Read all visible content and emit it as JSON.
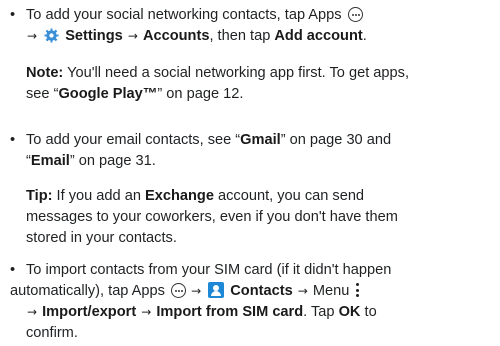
{
  "bullets": {
    "symbol": "•",
    "social": {
      "line1_text": "To add your social networking contacts, tap Apps",
      "settings_label": "Settings",
      "accounts_label": "Accounts",
      "then_tap": ", then tap",
      "add_account_label": "Add account",
      "period": "."
    },
    "email": {
      "line1_prefix": "To add your email contacts, see “",
      "gmail_label": "Gmail",
      "line1_suffix": "” on page 30 and",
      "email_open": "“",
      "email_label": "Email",
      "line2_suffix": "” on page 31."
    },
    "sim": {
      "line1_text": "To import contacts from your SIM card (if it didn't happen",
      "line2_prefix": "automatically), tap Apps",
      "contacts_label": "Contacts",
      "menu_label": "Menu",
      "import_export_label": "Import/export",
      "import_sim_label": "Import from SIM card",
      "tap_text": ". Tap",
      "ok_label": "OK",
      "to_text": "to",
      "line4_text": "confirm."
    }
  },
  "note": {
    "label": "Note:",
    "line1_text": "You'll need a social networking app first. To get apps,",
    "line2_prefix": "see “",
    "google_play_label": "Google Play™",
    "line2_suffix": "” on page 12."
  },
  "tip": {
    "label": "Tip:",
    "line1_prefix": "If you add an",
    "exchange_label": "Exchange",
    "line1_suffix": "account, you can send",
    "line2_text": "messages to your coworkers, even if you don't have them",
    "line3_text": "stored in your contacts."
  },
  "icons": {
    "arrow": "→",
    "apps_icon": "apps-icon",
    "settings_icon": "gear-icon",
    "contacts_icon": "contacts-icon",
    "menu_icon": "overflow-menu-icon",
    "contacts_icon_color": "#1e88d6",
    "settings_icon_color": "#3a8fd6"
  }
}
